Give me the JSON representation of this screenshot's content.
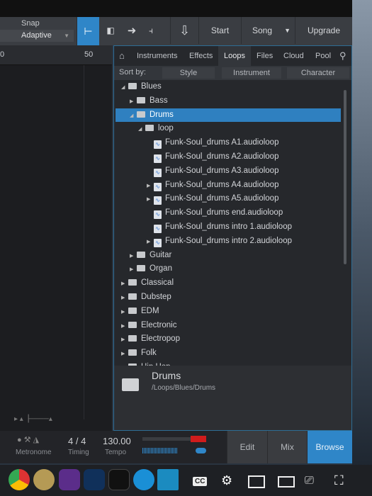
{
  "toolbar": {
    "snap_label": "Snap",
    "snap_value": "Adaptive",
    "start": "Start",
    "song": "Song",
    "upgrade": "Upgrade"
  },
  "ruler": {
    "marks": [
      "0",
      "50"
    ]
  },
  "browser": {
    "tabs": [
      "Instruments",
      "Effects",
      "Loops",
      "Files",
      "Cloud",
      "Pool"
    ],
    "active_tab": "Loops",
    "sort_by": "Sort by:",
    "sort_options": [
      "Style",
      "Instrument",
      "Character"
    ],
    "tree": [
      {
        "label": "Blues",
        "level": 0,
        "type": "folder",
        "expanded": true
      },
      {
        "label": "Bass",
        "level": 1,
        "type": "folder",
        "expanded": false
      },
      {
        "label": "Drums",
        "level": 1,
        "type": "folder",
        "expanded": true,
        "selected": true
      },
      {
        "label": "loop",
        "level": 2,
        "type": "folder",
        "expanded": true
      },
      {
        "label": "Funk-Soul_drums A1.audioloop",
        "level": 3,
        "type": "file"
      },
      {
        "label": "Funk-Soul_drums A2.audioloop",
        "level": 3,
        "type": "file"
      },
      {
        "label": "Funk-Soul_drums A3.audioloop",
        "level": 3,
        "type": "file"
      },
      {
        "label": "Funk-Soul_drums A4.audioloop",
        "level": 3,
        "type": "file",
        "expandable": true
      },
      {
        "label": "Funk-Soul_drums A5.audioloop",
        "level": 3,
        "type": "file",
        "expandable": true
      },
      {
        "label": "Funk-Soul_drums end.audioloop",
        "level": 3,
        "type": "file"
      },
      {
        "label": "Funk-Soul_drums intro 1.audioloop",
        "level": 3,
        "type": "file"
      },
      {
        "label": "Funk-Soul_drums intro 2.audioloop",
        "level": 3,
        "type": "file",
        "expandable": true
      },
      {
        "label": "Guitar",
        "level": 1,
        "type": "folder"
      },
      {
        "label": "Organ",
        "level": 1,
        "type": "folder"
      },
      {
        "label": "Classical",
        "level": 0,
        "type": "folder"
      },
      {
        "label": "Dubstep",
        "level": 0,
        "type": "folder"
      },
      {
        "label": "EDM",
        "level": 0,
        "type": "folder"
      },
      {
        "label": "Electronic",
        "level": 0,
        "type": "folder"
      },
      {
        "label": "Electropop",
        "level": 0,
        "type": "folder"
      },
      {
        "label": "Folk",
        "level": 0,
        "type": "folder"
      },
      {
        "label": "Hip Hop",
        "level": 0,
        "type": "folder"
      }
    ],
    "info": {
      "name": "Drums",
      "path": "/Loops/Blues/Drums"
    }
  },
  "transport": {
    "metronome": "Metronome",
    "timing_value": "4 / 4",
    "timing": "Timing",
    "tempo_value": "130.00",
    "tempo": "Tempo"
  },
  "views": {
    "edit": "Edit",
    "mix": "Mix",
    "browse": "Browse",
    "active": "Browse"
  },
  "colors": {
    "accent": "#2f86c8",
    "record": "#d01c1c"
  },
  "dock": {
    "overlay": [
      "CC"
    ]
  }
}
